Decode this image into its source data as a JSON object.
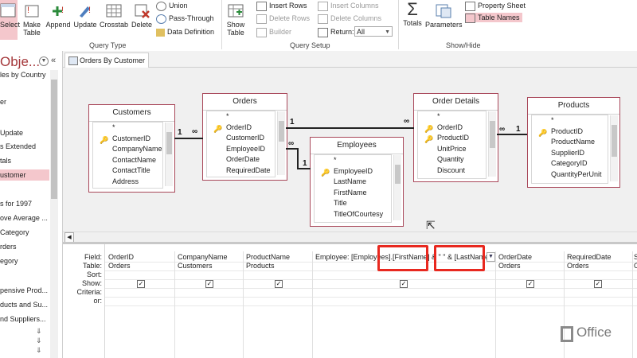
{
  "ribbon": {
    "query_type": {
      "label": "Query Type",
      "select": "Select",
      "make_table": [
        "Make",
        "Table"
      ],
      "append": "Append",
      "update": "Update",
      "crosstab": "Crosstab",
      "delete": "Delete",
      "union": "Union",
      "pass_through": "Pass-Through",
      "data_definition": "Data Definition"
    },
    "query_setup": {
      "label": "Query Setup",
      "show_table": [
        "Show",
        "Table"
      ],
      "insert_rows": "Insert Rows",
      "delete_rows": "Delete Rows",
      "builder": "Builder",
      "insert_columns": "Insert Columns",
      "delete_columns": "Delete Columns",
      "return_label": "Return:",
      "return_value": "All"
    },
    "show_hide": {
      "label": "Show/Hide",
      "totals": "Totals",
      "parameters": "Parameters",
      "property_sheet": "Property Sheet",
      "table_names": "Table Names"
    }
  },
  "nav": {
    "title": "Obje...",
    "items": [
      "les by Country",
      "er",
      "Update",
      "s Extended",
      "tals",
      "ustomer",
      "s for 1997",
      "ove Average ...",
      "Category",
      "rders",
      "egory",
      "pensive Prod...",
      "ducts and Su...",
      "nd Suppliers..."
    ]
  },
  "document_tab": {
    "label": "Orders By Customer"
  },
  "tables": {
    "customers": {
      "title": "Customers",
      "fields": [
        "*",
        "CustomerID",
        "CompanyName",
        "ContactName",
        "ContactTitle",
        "Address"
      ]
    },
    "orders": {
      "title": "Orders",
      "fields": [
        "*",
        "OrderID",
        "CustomerID",
        "EmployeeID",
        "OrderDate",
        "RequiredDate"
      ]
    },
    "employees": {
      "title": "Employees",
      "fields": [
        "*",
        "EmployeeID",
        "LastName",
        "FirstName",
        "Title",
        "TitleOfCourtesy"
      ]
    },
    "order_details": {
      "title": "Order Details",
      "fields": [
        "*",
        "OrderID",
        "ProductID",
        "UnitPrice",
        "Quantity",
        "Discount"
      ]
    },
    "products": {
      "title": "Products",
      "fields": [
        "*",
        "ProductID",
        "ProductName",
        "SupplierID",
        "CategoryID",
        "QuantityPerUnit"
      ]
    }
  },
  "relationships": {
    "one": "1",
    "many": "∞"
  },
  "grid": {
    "row_labels": [
      "Field:",
      "Table:",
      "Sort:",
      "Show:",
      "Criteria:",
      "or:"
    ],
    "columns": [
      {
        "field": "OrderID",
        "table": "Orders",
        "show": true
      },
      {
        "field": "CompanyName",
        "table": "Customers",
        "show": true
      },
      {
        "field": "ProductName",
        "table": "Products",
        "show": true
      },
      {
        "field": "Employee: [Employees].[FirstName] & \" \" & [LastName]",
        "table": "",
        "show": true
      },
      {
        "field": "OrderDate",
        "table": "Orders",
        "show": true
      },
      {
        "field": "RequiredDate",
        "table": "Orders",
        "show": true
      },
      {
        "field": "S",
        "table": "O",
        "show": null
      }
    ]
  },
  "brand": {
    "text": "Office"
  },
  "colors": {
    "accent": "#a4373a",
    "highlight": "#e8281f",
    "selected": "#f4c7cc"
  }
}
